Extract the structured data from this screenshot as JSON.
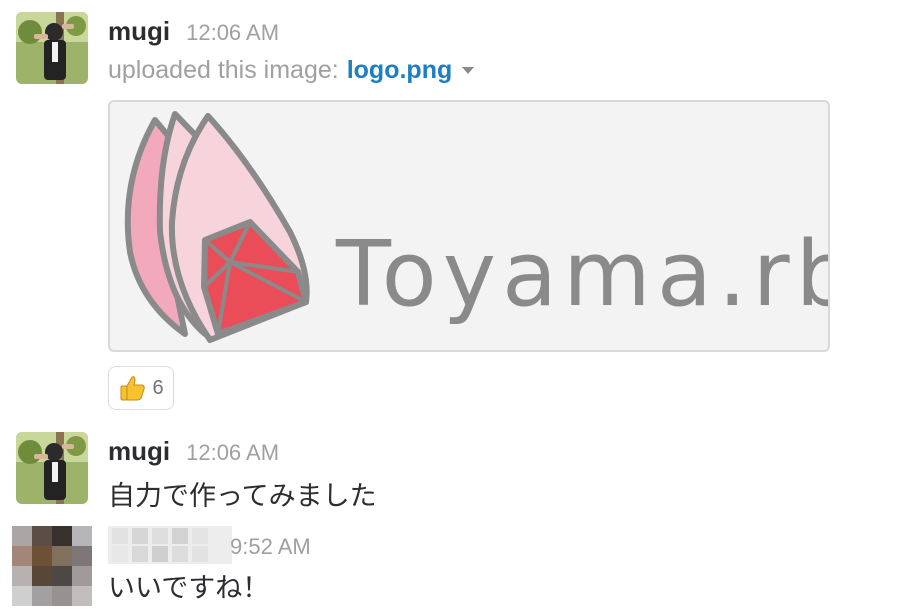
{
  "messages": [
    {
      "username": "mugi",
      "timestamp": "12:06 AM",
      "upload_prefix": "uploaded this image:",
      "file_name": "logo.png",
      "image_text": "Toyama.rb",
      "reaction": {
        "emoji": "thumbs-up",
        "count": "6"
      }
    },
    {
      "username": "mugi",
      "timestamp": "12:06 AM",
      "text": "自力で作ってみました"
    },
    {
      "timestamp": "9:52 AM",
      "text": "いいですね！"
    }
  ],
  "colors": {
    "link": "#1d7ec1",
    "muted": "#a0a0a2",
    "logo_pink_dark": "#f2a9bb",
    "logo_pink_light": "#f7d3dc",
    "ruby_red": "#ea4d58",
    "logo_gray": "#8a8a8a"
  }
}
